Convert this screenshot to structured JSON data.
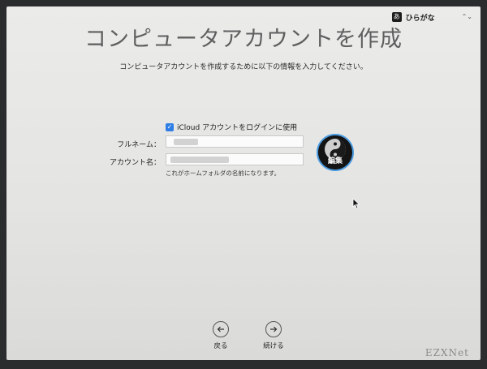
{
  "input_menu": {
    "badge": "あ",
    "label": "ひらがな",
    "arrows": "⌃⌄"
  },
  "title": "コンピュータアカウントを作成",
  "subtitle": "コンピュータアカウントを作成するために以下の情報を入力してください。",
  "icloud_checkbox": {
    "checked": true,
    "mark": "✓",
    "label": "iCloud アカウントをログインに使用"
  },
  "fields": {
    "full_name": {
      "label": "フルネーム：",
      "value": ""
    },
    "account_name": {
      "label": "アカウント名：",
      "value": "",
      "hint": "これがホームフォルダの名前になります。"
    }
  },
  "avatar": {
    "edit_label": "編集",
    "ring_color": "#4b9be0"
  },
  "nav": {
    "back_label": "戻る",
    "continue_label": "続ける"
  },
  "watermark": "EZXNet",
  "colors": {
    "accent": "#2f7ee6",
    "background": "#e8e8e6"
  }
}
